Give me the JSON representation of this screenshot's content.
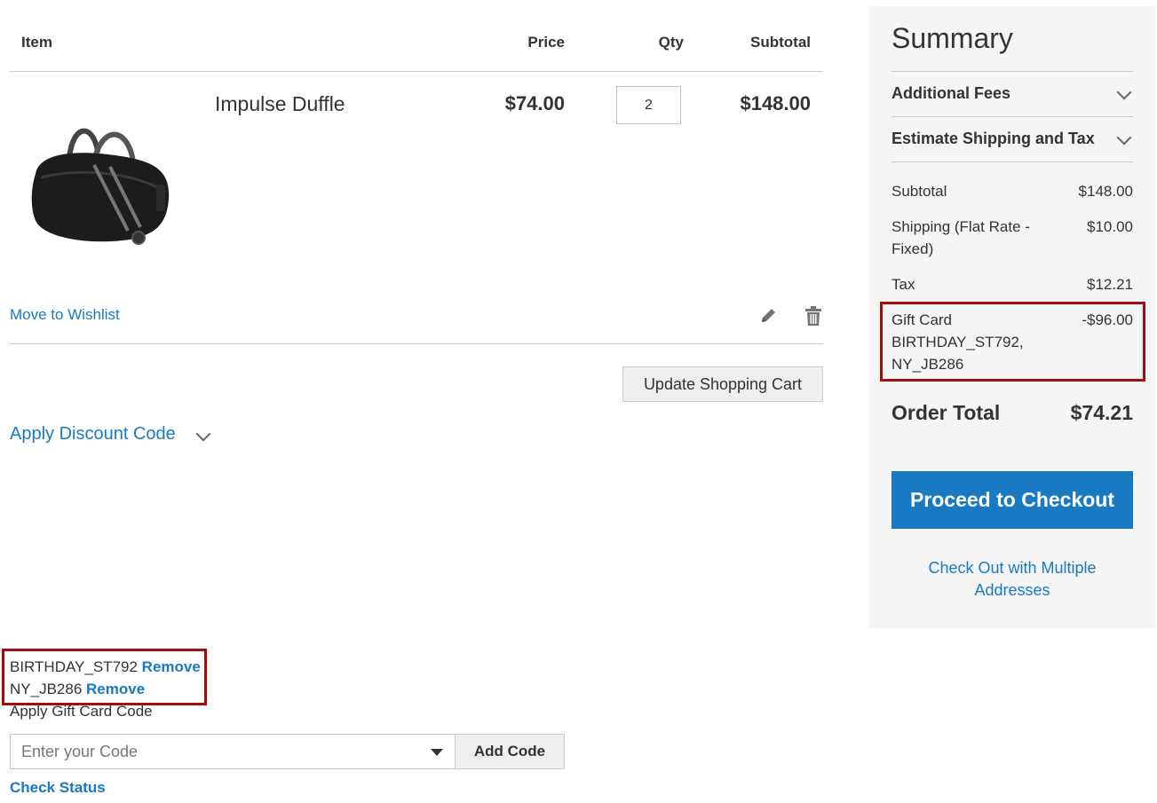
{
  "table": {
    "headers": {
      "item": "Item",
      "price": "Price",
      "qty": "Qty",
      "subtotal": "Subtotal"
    }
  },
  "cart_item": {
    "name": "Impulse Duffle",
    "price": "$74.00",
    "qty": "2",
    "subtotal": "$148.00",
    "move_to_wishlist": "Move to Wishlist",
    "edit_icon": "pencil-icon",
    "delete_icon": "trash-icon"
  },
  "actions": {
    "update_cart": "Update Shopping Cart",
    "apply_discount": "Apply Discount Code"
  },
  "gift_cards": {
    "applied": [
      {
        "code": "BIRTHDAY_ST792",
        "remove": "Remove"
      },
      {
        "code": "NY_JB286",
        "remove": "Remove"
      }
    ],
    "apply_label": "Apply Gift Card Code",
    "input_placeholder": "Enter your Code",
    "add_code": "Add Code",
    "check_status": "Check Status"
  },
  "summary": {
    "title": "Summary",
    "additional_fees": "Additional Fees",
    "estimate_shipping": "Estimate Shipping and Tax",
    "subtotal_label": "Subtotal",
    "subtotal_value": "$148.00",
    "shipping_label_1": "Shipping (Flat Rate -",
    "shipping_label_2": "Fixed)",
    "shipping_value": "$10.00",
    "tax_label": "Tax",
    "tax_value": "$12.21",
    "gift_card_label": "Gift Card",
    "gift_card_codes_1": "BIRTHDAY_ST792,",
    "gift_card_codes_2": "NY_JB286",
    "gift_card_value": "-$96.00",
    "order_total_label": "Order Total",
    "order_total_value": "$74.21",
    "checkout": "Proceed to Checkout",
    "multi_address_1": "Check Out with Multiple",
    "multi_address_2": "Addresses"
  },
  "colors": {
    "accent": "#1979c3",
    "highlight": "#a30c0c",
    "sidebar_bg": "#f5f5f5"
  }
}
